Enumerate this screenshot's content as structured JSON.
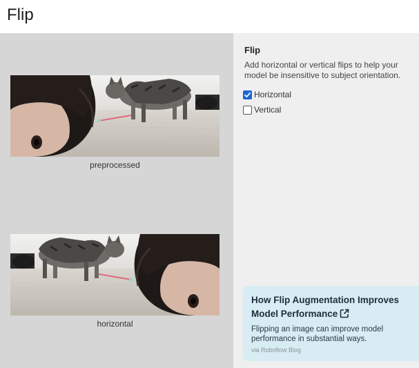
{
  "page": {
    "title": "Flip"
  },
  "preview": {
    "images": [
      {
        "caption": "preprocessed",
        "image_desc": "person-head-and-cat-with-laser"
      },
      {
        "caption": "horizontal",
        "image_desc": "person-head-and-cat-with-laser-flipped"
      }
    ]
  },
  "settings": {
    "heading": "Flip",
    "description": "Add horizontal or vertical flips to help your model be insensitive to subject orientation.",
    "options": [
      {
        "label": "Horizontal",
        "checked": true
      },
      {
        "label": "Vertical",
        "checked": false
      }
    ]
  },
  "blog_card": {
    "title": "How Flip Augmentation Improves Model Performance",
    "description": "Flipping an image can improve model performance in substantial ways.",
    "source": "via Roboflow Blog",
    "icon": "external-link-icon"
  },
  "colors": {
    "preview_bg": "#d6d6d6",
    "settings_bg": "#efefef",
    "card_bg": "#d7ecf3",
    "checkbox_accent": "#1a66d6"
  }
}
